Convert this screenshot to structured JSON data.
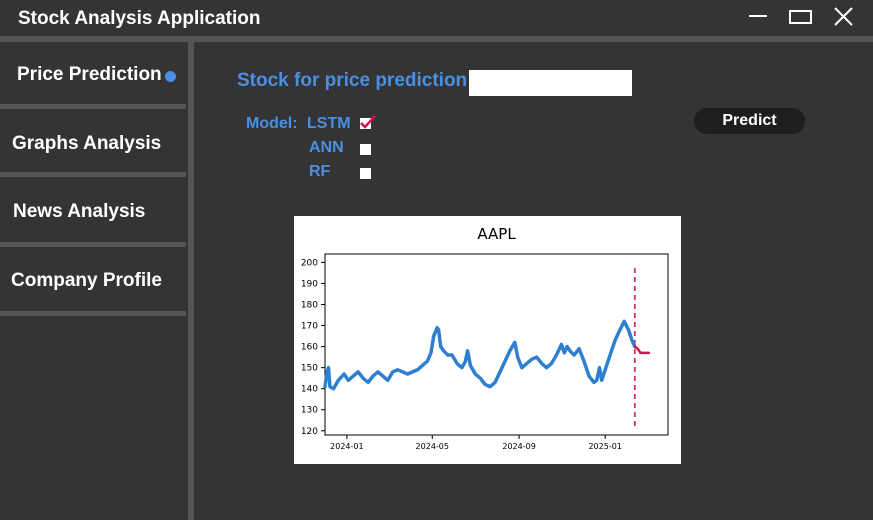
{
  "window": {
    "title": "Stock Analysis Application",
    "controls": [
      "minimize-icon",
      "maximize-icon",
      "close-icon"
    ]
  },
  "sidebar": {
    "items": [
      {
        "label": "Price Prediction",
        "active": true
      },
      {
        "label": "Graphs Analysis",
        "active": false
      },
      {
        "label": "News Analysis",
        "active": false
      },
      {
        "label": "Company Profile",
        "active": false
      }
    ]
  },
  "main": {
    "stock_label": "Stock for price prediction:",
    "stock_value": "",
    "model_label": "Model:",
    "models": [
      {
        "label": "LSTM",
        "checked": true
      },
      {
        "label": "ANN",
        "checked": false
      },
      {
        "label": "RF",
        "checked": false
      }
    ],
    "predict_label": "Predict"
  },
  "colors": {
    "accent": "#4a90e2",
    "background": "#343434",
    "separator": "#555555",
    "history_line": "#2f7fd1",
    "prediction_line": "#d6124a"
  },
  "chart_data": {
    "type": "line",
    "title": "AAPL",
    "xlabel": "",
    "ylabel": "",
    "ylim": [
      118,
      204
    ],
    "yticks": [
      120,
      130,
      140,
      150,
      160,
      170,
      180,
      190,
      200
    ],
    "xticks": [
      {
        "label": "2024-01",
        "date": "2024-01-01"
      },
      {
        "label": "2024-05",
        "date": "2024-05-01"
      },
      {
        "label": "2024-09",
        "date": "2024-09-01"
      },
      {
        "label": "2025-01",
        "date": "2025-01-01"
      }
    ],
    "xlim": [
      "2023-12-01",
      "2025-03-31"
    ],
    "series": [
      {
        "role": "history",
        "color": "#2f7fd1",
        "points": [
          [
            "2023-12-01",
            141
          ],
          [
            "2023-12-04",
            148
          ],
          [
            "2023-12-06",
            150
          ],
          [
            "2023-12-08",
            141
          ],
          [
            "2023-12-13",
            140
          ],
          [
            "2023-12-20",
            144
          ],
          [
            "2023-12-28",
            147
          ],
          [
            "2024-01-03",
            144
          ],
          [
            "2024-01-10",
            146
          ],
          [
            "2024-01-17",
            148
          ],
          [
            "2024-01-24",
            145
          ],
          [
            "2024-01-31",
            143
          ],
          [
            "2024-02-07",
            146
          ],
          [
            "2024-02-14",
            148
          ],
          [
            "2024-02-21",
            146
          ],
          [
            "2024-02-28",
            144
          ],
          [
            "2024-03-06",
            148
          ],
          [
            "2024-03-13",
            149
          ],
          [
            "2024-03-20",
            148
          ],
          [
            "2024-03-27",
            147
          ],
          [
            "2024-04-03",
            148
          ],
          [
            "2024-04-10",
            149
          ],
          [
            "2024-04-17",
            151
          ],
          [
            "2024-04-24",
            153
          ],
          [
            "2024-04-29",
            157
          ],
          [
            "2024-05-03",
            165
          ],
          [
            "2024-05-08",
            169
          ],
          [
            "2024-05-10",
            168
          ],
          [
            "2024-05-13",
            160
          ],
          [
            "2024-05-17",
            158
          ],
          [
            "2024-05-23",
            156
          ],
          [
            "2024-05-29",
            156
          ],
          [
            "2024-06-05",
            152
          ],
          [
            "2024-06-12",
            150
          ],
          [
            "2024-06-17",
            153
          ],
          [
            "2024-06-20",
            158
          ],
          [
            "2024-06-24",
            151
          ],
          [
            "2024-07-01",
            147
          ],
          [
            "2024-07-08",
            145
          ],
          [
            "2024-07-15",
            142
          ],
          [
            "2024-07-22",
            141
          ],
          [
            "2024-07-29",
            143
          ],
          [
            "2024-08-05",
            148
          ],
          [
            "2024-08-12",
            153
          ],
          [
            "2024-08-19",
            158
          ],
          [
            "2024-08-26",
            162
          ],
          [
            "2024-08-30",
            155
          ],
          [
            "2024-09-05",
            150
          ],
          [
            "2024-09-12",
            152
          ],
          [
            "2024-09-19",
            154
          ],
          [
            "2024-09-26",
            155
          ],
          [
            "2024-10-03",
            152
          ],
          [
            "2024-10-10",
            150
          ],
          [
            "2024-10-17",
            152
          ],
          [
            "2024-10-24",
            156
          ],
          [
            "2024-10-31",
            161
          ],
          [
            "2024-11-04",
            157
          ],
          [
            "2024-11-08",
            160
          ],
          [
            "2024-11-12",
            158
          ],
          [
            "2024-11-18",
            156
          ],
          [
            "2024-11-25",
            159
          ],
          [
            "2024-12-02",
            153
          ],
          [
            "2024-12-09",
            146
          ],
          [
            "2024-12-16",
            143
          ],
          [
            "2024-12-20",
            144
          ],
          [
            "2024-12-24",
            150
          ],
          [
            "2024-12-27",
            144
          ],
          [
            "2024-12-31",
            148
          ],
          [
            "2025-01-08",
            156
          ],
          [
            "2025-01-15",
            163
          ],
          [
            "2025-01-22",
            168
          ],
          [
            "2025-01-28",
            172
          ],
          [
            "2025-02-03",
            168
          ],
          [
            "2025-02-08",
            163
          ],
          [
            "2025-02-12",
            160
          ]
        ]
      },
      {
        "role": "prediction",
        "color": "#d6124a",
        "points": [
          [
            "2025-02-12",
            160
          ],
          [
            "2025-02-16",
            159
          ],
          [
            "2025-02-20",
            157
          ],
          [
            "2025-02-26",
            157
          ],
          [
            "2025-03-04",
            157
          ]
        ]
      }
    ],
    "vline": {
      "date": "2025-02-12",
      "style": "dashed",
      "color": "#d6124a"
    },
    "grid": false
  }
}
